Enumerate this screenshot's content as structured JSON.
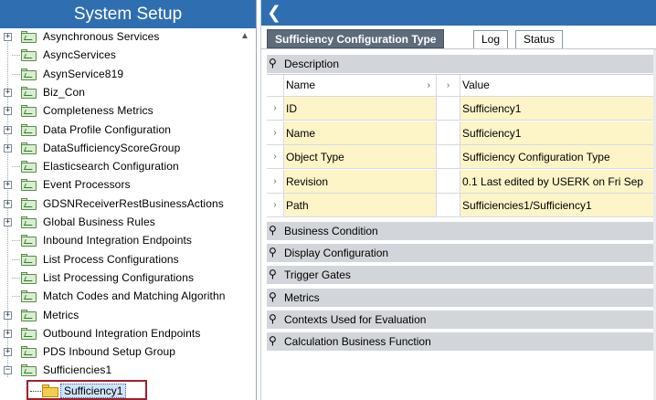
{
  "left_panel": {
    "title": "System Setup",
    "tree_items": [
      {
        "label": "Asynchronous Services",
        "expandable": true
      },
      {
        "label": "AsyncServices",
        "expandable": false
      },
      {
        "label": "AsynService819",
        "expandable": false
      },
      {
        "label": "Biz_Con",
        "expandable": true
      },
      {
        "label": "Completeness Metrics",
        "expandable": true
      },
      {
        "label": "Data Profile Configuration",
        "expandable": true
      },
      {
        "label": "DataSufficiencyScoreGroup",
        "expandable": true
      },
      {
        "label": "Elasticsearch Configuration",
        "expandable": false
      },
      {
        "label": "Event Processors",
        "expandable": true
      },
      {
        "label": "GDSNReceiverRestBusinessActions",
        "expandable": true
      },
      {
        "label": "Global Business Rules",
        "expandable": true
      },
      {
        "label": "Inbound Integration Endpoints",
        "expandable": false
      },
      {
        "label": "List Process Configurations",
        "expandable": false
      },
      {
        "label": "List Processing Configurations",
        "expandable": false
      },
      {
        "label": "Match Codes and Matching Algorithn",
        "expandable": false
      },
      {
        "label": "Metrics",
        "expandable": true
      },
      {
        "label": "Outbound Integration Endpoints",
        "expandable": true
      },
      {
        "label": "PDS Inbound Setup Group",
        "expandable": true
      },
      {
        "label": "Sufficiencies1",
        "expandable": true,
        "expanded": true
      }
    ],
    "selected_item": {
      "label": "Sufficiency1"
    },
    "expander_plus": "+",
    "expander_minus": "−",
    "scroll_up_glyph": "▲"
  },
  "right_panel": {
    "back_glyph": "❮",
    "tabs": {
      "active": "Sufficiency Configuration Type",
      "log": "Log",
      "status": "Status"
    },
    "description_section": {
      "label": "Description",
      "columns": {
        "name": "Name",
        "value": "Value"
      },
      "rows": [
        {
          "name": "ID",
          "value": "Sufficiency1"
        },
        {
          "name": "Name",
          "value": "Sufficiency1"
        },
        {
          "name": "Object Type",
          "value": "Sufficiency Configuration Type"
        },
        {
          "name": "Revision",
          "value": "0.1 Last edited by USERK on Fri Sep"
        },
        {
          "name": "Path",
          "value": "Sufficiencies1/Sufficiency1"
        }
      ]
    },
    "collapsed_sections": [
      "Business Condition",
      "Display Configuration",
      "Trigger Gates",
      "Metrics",
      "Contexts Used for Evaluation",
      "Calculation Business Function"
    ],
    "row_arrow": "›",
    "header_arrow": "›"
  },
  "colors": {
    "title_bar": "#2f6fb1",
    "tree_folder": "#d9edd0",
    "selected_folder": "#f5cd4e",
    "selection_outline": "#a0202a",
    "grid_cell": "#fdf5c8",
    "section_header": "#d2d5d9",
    "active_tab": "#5d6b7a"
  }
}
